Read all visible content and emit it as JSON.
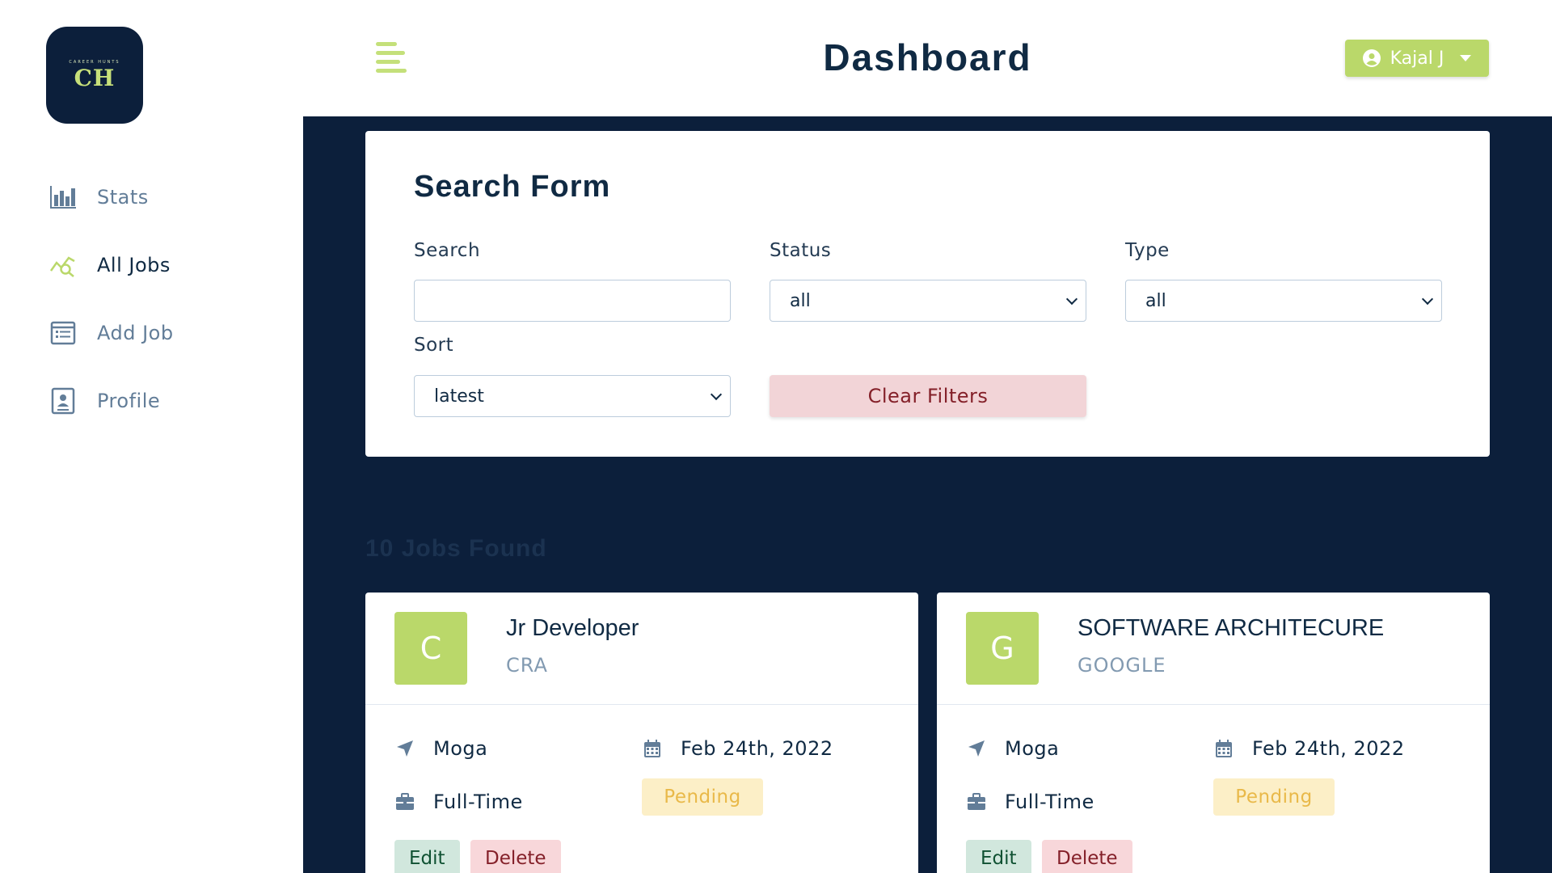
{
  "logo": {
    "tagline": "CAREER HUNTS",
    "monogram": "CH"
  },
  "sidebar": {
    "items": [
      {
        "label": "Stats",
        "icon": "bar-chart-icon"
      },
      {
        "label": "All Jobs",
        "icon": "search-chart-icon",
        "active": true
      },
      {
        "label": "Add Job",
        "icon": "form-icon"
      },
      {
        "label": "Profile",
        "icon": "profile-card-icon"
      }
    ]
  },
  "header": {
    "title": "Dashboard",
    "user_name": "Kajal J"
  },
  "search_form": {
    "title": "Search Form",
    "search_label": "Search",
    "search_value": "",
    "status_label": "Status",
    "status_value": "all",
    "type_label": "Type",
    "type_value": "all",
    "sort_label": "Sort",
    "sort_value": "latest",
    "clear_label": "Clear Filters"
  },
  "jobs_found": "10 Jobs Found",
  "jobs": [
    {
      "letter": "C",
      "title": "Jr Developer",
      "company": "CRA",
      "location": "Moga",
      "date": "Feb 24th, 2022",
      "type": "Full-Time",
      "status": "Pending",
      "edit_label": "Edit",
      "delete_label": "Delete"
    },
    {
      "letter": "G",
      "title": "SOFTWARE ARCHITECURE",
      "company": "GOOGLE",
      "location": "Moga",
      "date": "Feb 24th, 2022",
      "type": "Full-Time",
      "status": "Pending",
      "edit_label": "Edit",
      "delete_label": "Delete"
    }
  ],
  "colors": {
    "accent": "#bad86a",
    "navy": "#0c1f3b",
    "danger_bg": "#f8d7da",
    "pending_bg": "#fcefc7"
  }
}
